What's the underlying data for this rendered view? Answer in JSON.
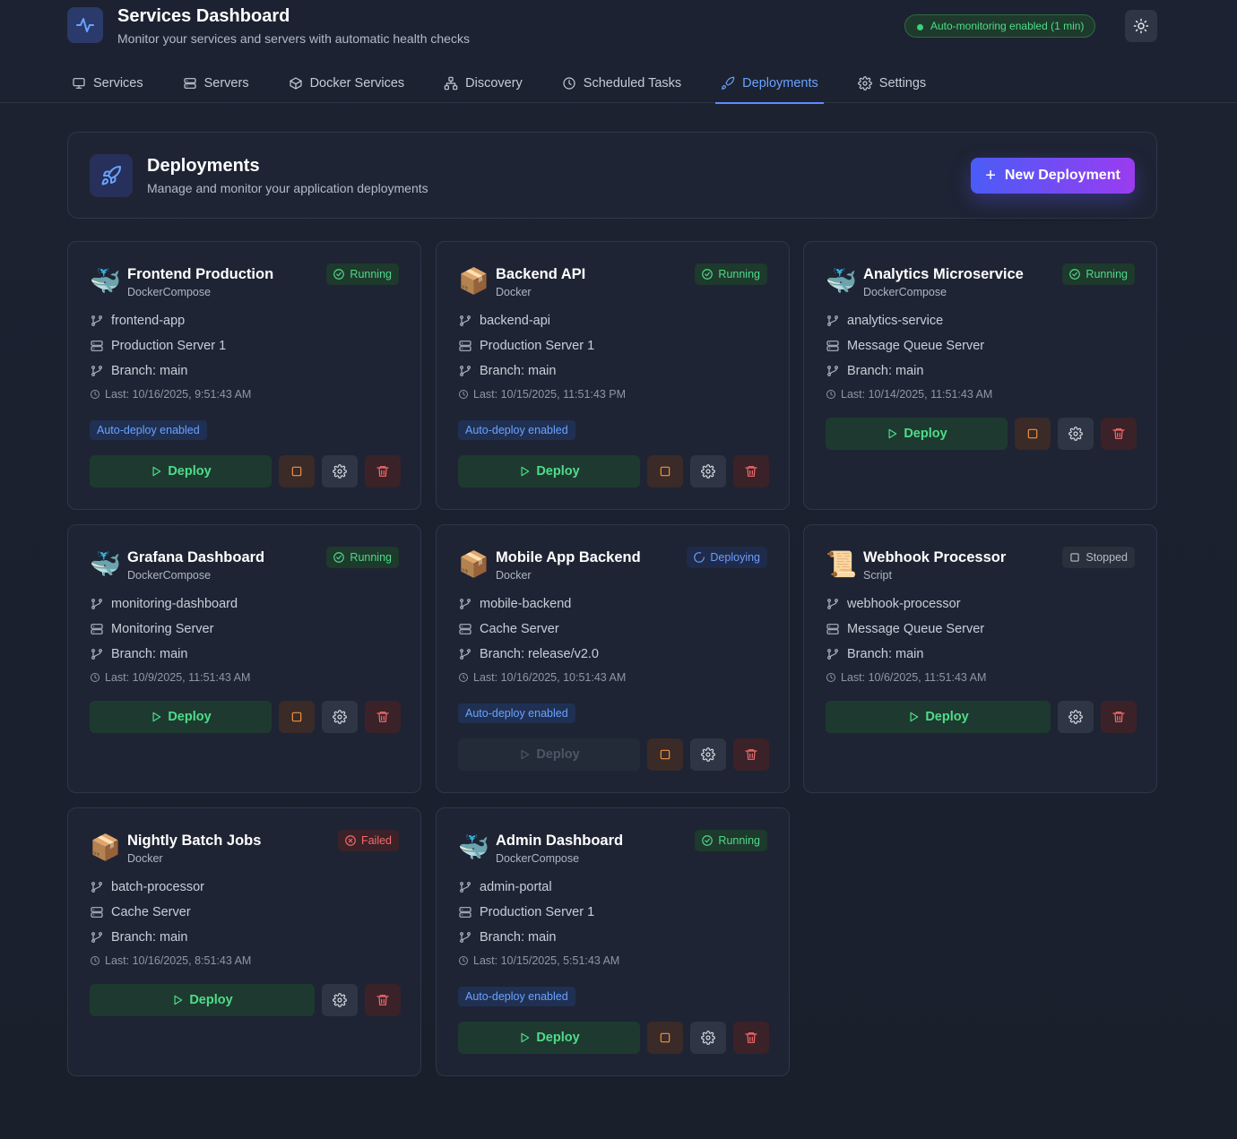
{
  "app": {
    "title": "Services Dashboard",
    "subtitle": "Monitor your services and servers with automatic health checks",
    "monitoring": "Auto-monitoring enabled (1 min)"
  },
  "tabs": [
    {
      "label": "Services",
      "icon": "monitor-icon"
    },
    {
      "label": "Servers",
      "icon": "server-icon"
    },
    {
      "label": "Docker Services",
      "icon": "box-icon"
    },
    {
      "label": "Discovery",
      "icon": "network-icon"
    },
    {
      "label": "Scheduled Tasks",
      "icon": "clock-icon"
    },
    {
      "label": "Deployments",
      "icon": "rocket-icon",
      "active": true
    },
    {
      "label": "Settings",
      "icon": "gear-icon"
    }
  ],
  "page": {
    "title": "Deployments",
    "subtitle": "Manage and monitor your application deployments",
    "new_button": "New Deployment"
  },
  "labels": {
    "deploy": "Deploy",
    "auto_deploy": "Auto-deploy enabled"
  },
  "colors": {
    "accent": "#5b8cff",
    "running": "#52d88a",
    "failed": "#f36b6b",
    "deploying": "#6b9dff",
    "stopped": "#b7bdc8"
  },
  "deployments": [
    {
      "name": "Frontend Production",
      "type": "DockerCompose",
      "emoji": "🐳",
      "status": "Running",
      "repo": "frontend-app",
      "server": "Production Server 1",
      "branch": "Branch: main",
      "last": "Last: 10/16/2025, 9:51:43 AM",
      "auto": true
    },
    {
      "name": "Backend API",
      "type": "Docker",
      "emoji": "📦",
      "status": "Running",
      "repo": "backend-api",
      "server": "Production Server 1",
      "branch": "Branch: main",
      "last": "Last: 10/15/2025, 11:51:43 PM",
      "auto": true
    },
    {
      "name": "Analytics Microservice",
      "type": "DockerCompose",
      "emoji": "🐳",
      "status": "Running",
      "repo": "analytics-service",
      "server": "Message Queue Server",
      "branch": "Branch: main",
      "last": "Last: 10/14/2025, 11:51:43 AM",
      "auto": false
    },
    {
      "name": "Grafana Dashboard",
      "type": "DockerCompose",
      "emoji": "🐳",
      "status": "Running",
      "repo": "monitoring-dashboard",
      "server": "Monitoring Server",
      "branch": "Branch: main",
      "last": "Last: 10/9/2025, 11:51:43 AM",
      "auto": false
    },
    {
      "name": "Mobile App Backend",
      "type": "Docker",
      "emoji": "📦",
      "status": "Deploying",
      "repo": "mobile-backend",
      "server": "Cache Server",
      "branch": "Branch: release/v2.0",
      "last": "Last: 10/16/2025, 10:51:43 AM",
      "auto": true
    },
    {
      "name": "Webhook Processor",
      "type": "Script",
      "emoji": "📜",
      "status": "Stopped",
      "repo": "webhook-processor",
      "server": "Message Queue Server",
      "branch": "Branch: main",
      "last": "Last: 10/6/2025, 11:51:43 AM",
      "auto": false
    },
    {
      "name": "Nightly Batch Jobs",
      "type": "Docker",
      "emoji": "📦",
      "status": "Failed",
      "repo": "batch-processor",
      "server": "Cache Server",
      "branch": "Branch: main",
      "last": "Last: 10/16/2025, 8:51:43 AM",
      "auto": false
    },
    {
      "name": "Admin Dashboard",
      "type": "DockerCompose",
      "emoji": "🐳",
      "status": "Running",
      "repo": "admin-portal",
      "server": "Production Server 1",
      "branch": "Branch: main",
      "last": "Last: 10/15/2025, 5:51:43 AM",
      "auto": true
    }
  ]
}
